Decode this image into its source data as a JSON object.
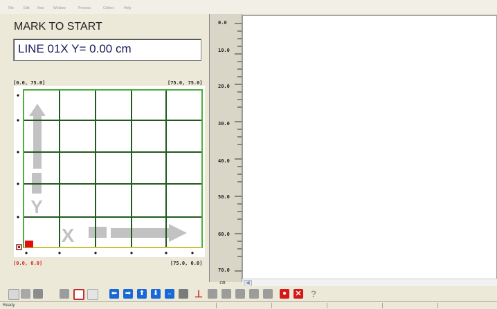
{
  "menu": [
    "File",
    "Edit",
    "View",
    "Window",
    "Process",
    "Collect",
    "Help"
  ],
  "panel": {
    "title": "MARK TO START",
    "line_status": "LINE 01X  Y=   0.00 cm"
  },
  "grid": {
    "corner_top_left": "[0.0, 75.0]",
    "corner_top_right": "[75.0, 75.0]",
    "corner_bottom_left": "[0.0, 0.0]",
    "corner_bottom_right": "[75.0, 0.0]",
    "axis_x": "X",
    "axis_y": "Y",
    "line_color": "#1f5a1f",
    "border_color": "#4caf3a",
    "arrow_color": "#c2c2c2",
    "start_marker_color": "#e01010"
  },
  "ruler": {
    "labels": [
      "0.0",
      "10.0",
      "20.0",
      "30.0",
      "40.0",
      "50.0",
      "60.0",
      "70.0"
    ],
    "unit": "cm"
  },
  "statusbar": {
    "text": "Ready"
  },
  "toolbar": {
    "buttons": [
      "doc-icon",
      "open-icon",
      "save-icon",
      "monitor-icon",
      "grid-icon",
      "copy-icon",
      "arrow-left-icon",
      "arrow-right-icon",
      "arrow-up-icon",
      "arrow-down-icon",
      "arrows-horizontal-icon",
      "pause-icon",
      "marker-icon",
      "gray-box-1-icon",
      "gray-box-2-icon",
      "gray-box-3-icon",
      "gray-box-4-icon",
      "record-icon",
      "stop-x-icon",
      "help-icon"
    ]
  }
}
